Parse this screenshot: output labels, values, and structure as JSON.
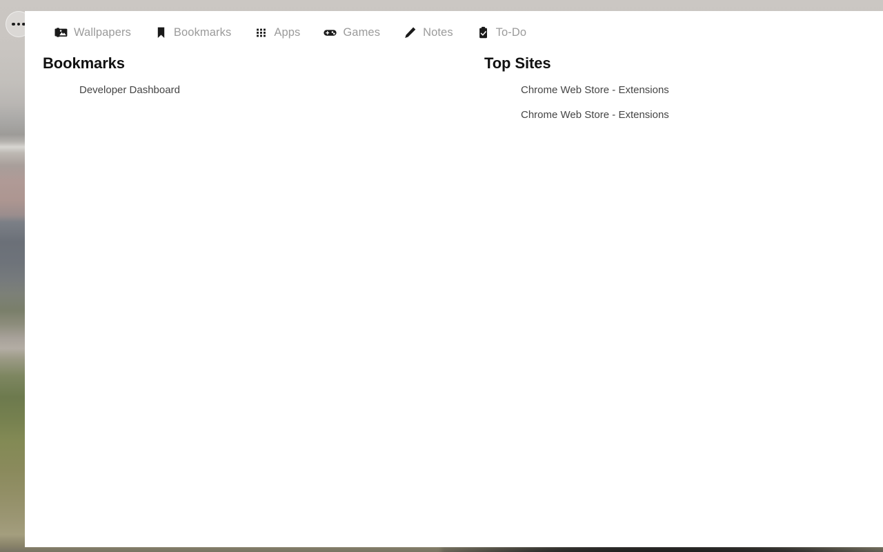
{
  "window": {
    "more_button_label": "More options",
    "more_dots": 3
  },
  "nav": {
    "items": [
      {
        "id": "wallpapers",
        "label": "Wallpapers",
        "icon": "images-stack-icon"
      },
      {
        "id": "bookmarks",
        "label": "Bookmarks",
        "icon": "bookmark-ribbon-icon"
      },
      {
        "id": "apps",
        "label": "Apps",
        "icon": "grid-dots-icon"
      },
      {
        "id": "games",
        "label": "Games",
        "icon": "gamepad-icon"
      },
      {
        "id": "notes",
        "label": "Notes",
        "icon": "pencil-icon"
      },
      {
        "id": "todo",
        "label": "To-Do",
        "icon": "clipboard-check-icon"
      }
    ]
  },
  "columns": [
    {
      "id": "bookmarks",
      "title": "Bookmarks",
      "items": [
        {
          "label": "Developer Dashboard"
        }
      ]
    },
    {
      "id": "top-sites",
      "title": "Top Sites",
      "items": [
        {
          "label": "Chrome Web Store - Extensions"
        },
        {
          "label": "Chrome Web Store - Extensions"
        }
      ]
    }
  ],
  "colors": {
    "panel_background": "#ffffff",
    "nav_label": "#9b9b9b",
    "nav_icon": "#1a1a1a",
    "heading": "#111111",
    "link": "#444444",
    "page_background": "#cac6c2"
  }
}
